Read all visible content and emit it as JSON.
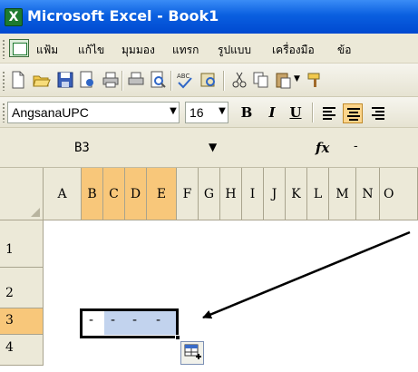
{
  "window": {
    "title": "Microsoft Excel - Book1",
    "icon": "excel-app-icon",
    "icon_letter": "X"
  },
  "menubar": {
    "items": [
      {
        "label": "แฟ้ม"
      },
      {
        "label": "แก้ไข"
      },
      {
        "label": "มุมมอง"
      },
      {
        "label": "แทรก"
      },
      {
        "label": "รูปแบบ"
      },
      {
        "label": "เครื่องมือ"
      },
      {
        "label": "ข้อ"
      }
    ]
  },
  "toolbar": {
    "icons": [
      "new-icon",
      "open-icon",
      "save-icon",
      "permission-icon",
      "print-icon",
      "print-preview-icon",
      "spelling-icon",
      "research-icon",
      "cut-icon",
      "copy-icon",
      "paste-icon",
      "format-painter-icon"
    ]
  },
  "formatbar": {
    "font_name": "AngsanaUPC",
    "font_size": "16",
    "bold_label": "B",
    "italic_label": "I",
    "underline_label": "U"
  },
  "formulabar": {
    "name_box": "B3",
    "fx_label": "fx",
    "formula_value": "-"
  },
  "grid": {
    "columns": [
      "A",
      "B",
      "C",
      "D",
      "E",
      "F",
      "G",
      "H",
      "I",
      "J",
      "K",
      "L",
      "M",
      "N",
      "O"
    ],
    "selected_columns": [
      "B",
      "C",
      "D",
      "E"
    ],
    "rows": [
      "1",
      "2",
      "3",
      "4"
    ],
    "selected_row": "3",
    "active_cell": "B3",
    "selected_range": "B3:E3",
    "cells": [
      {
        "ref": "B3",
        "value": "-"
      },
      {
        "ref": "C3",
        "value": "-"
      },
      {
        "ref": "D3",
        "value": "-"
      },
      {
        "ref": "E3",
        "value": "-"
      }
    ]
  },
  "colors": {
    "title_bar": "#0a5fe0",
    "selected_header": "#f8c77a",
    "selection_fill": "#c2d3ee",
    "chrome": "#ece9d8"
  }
}
